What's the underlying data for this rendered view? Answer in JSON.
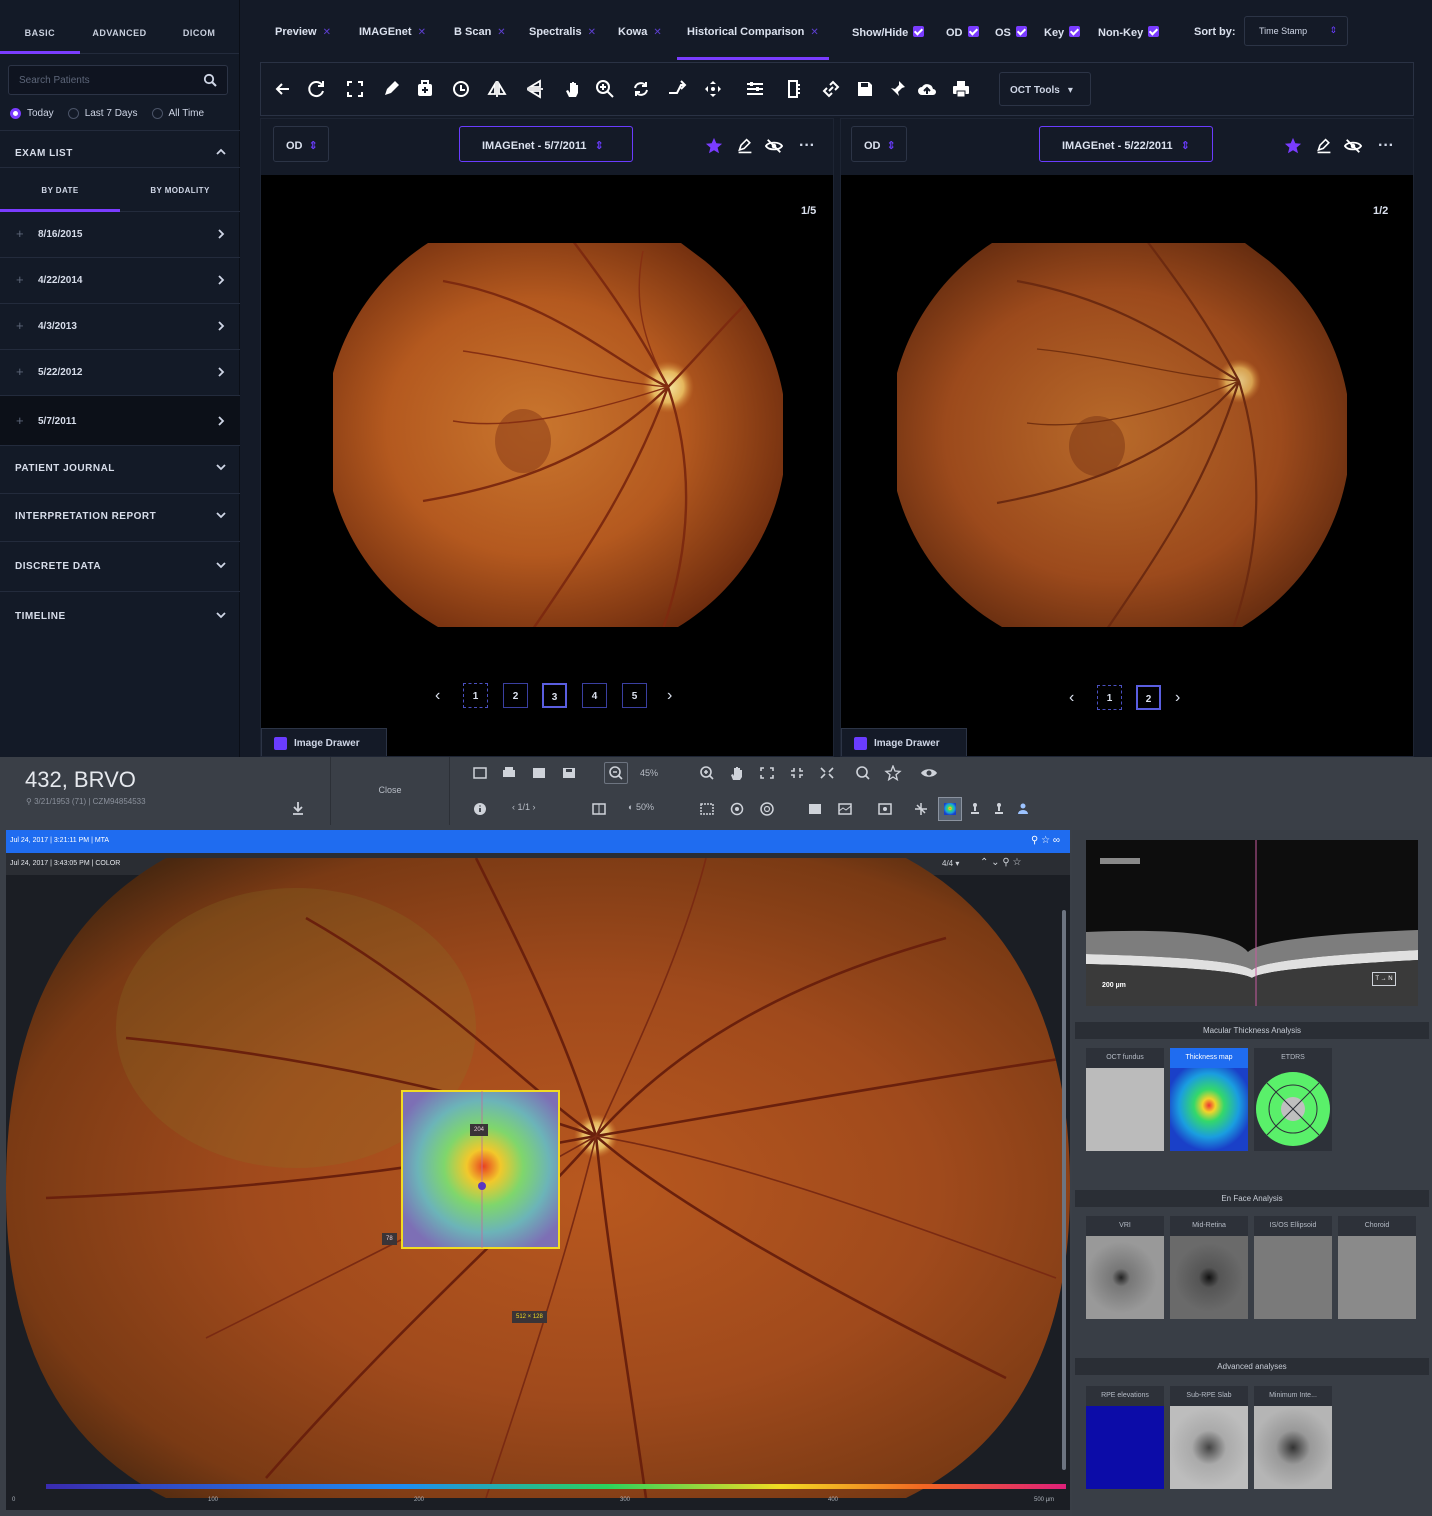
{
  "sidebar": {
    "tabs": [
      "BASIC",
      "ADVANCED",
      "DICOM"
    ],
    "search_placeholder": "Search Patients",
    "radios": [
      "Today",
      "Last 7 Days",
      "All Time"
    ],
    "exam_list_label": "EXAM LIST",
    "subtabs": [
      "BY DATE",
      "BY MODALITY"
    ],
    "dates": [
      "8/16/2015",
      "4/22/2014",
      "4/3/2013",
      "5/22/2012",
      "5/7/2011"
    ],
    "sections": [
      "PATIENT JOURNAL",
      "INTERPRETATION REPORT",
      "DISCRETE DATA",
      "TIMELINE"
    ]
  },
  "tabs": [
    {
      "label": "Preview"
    },
    {
      "label": "IMAGEnet"
    },
    {
      "label": "B Scan"
    },
    {
      "label": "Spectralis"
    },
    {
      "label": "Kowa"
    },
    {
      "label": "Historical Comparison"
    }
  ],
  "filters": {
    "show_hide": "Show/Hide",
    "od": "OD",
    "os": "OS",
    "key": "Key",
    "non_key": "Non-Key",
    "sort_by": "Sort by:",
    "sort_value": "Time Stamp"
  },
  "toolbar": {
    "oct_tools": "OCT Tools"
  },
  "left_viewer": {
    "eye": "OD",
    "image": "IMAGEnet - 5/7/2011",
    "counter": "1/5",
    "pages": [
      "1",
      "2",
      "3",
      "4",
      "5"
    ],
    "drawer": "Image Drawer"
  },
  "right_viewer": {
    "eye": "OD",
    "image": "IMAGEnet - 5/22/2011",
    "counter": "1/2",
    "pages": [
      "1",
      "2"
    ],
    "drawer": "Image Drawer"
  },
  "patient": {
    "title": "432, BRVO",
    "info": "3/21/1953 (71) | CZM94854533",
    "close": "Close"
  },
  "viewer2": {
    "zoom": "45%",
    "page": "1/1",
    "opacity": "50%",
    "bar1": "Jul 24, 2017 | 3:21:11 PM | MTA",
    "bar2": "Jul 24, 2017 | 3:43:05 PM | COLOR",
    "bar2_right": "4/4",
    "label_top": "204",
    "label_left": "78",
    "label_bottom": "512 × 128",
    "scale": [
      "0",
      "100",
      "200",
      "300",
      "400",
      "500 µm"
    ]
  },
  "oct": {
    "scale": "200 µm",
    "dir": "T → N"
  },
  "macular": {
    "title": "Macular Thickness Analysis",
    "items": [
      "OCT fundus",
      "Thickness map",
      "ETDRS"
    ]
  },
  "enface": {
    "title": "En Face Analysis",
    "items": [
      "VRI",
      "Mid-Retina",
      "IS/OS Ellipsoid",
      "Choroid"
    ]
  },
  "advanced": {
    "title": "Advanced analyses",
    "items": [
      "RPE elevations",
      "Sub-RPE Slab",
      "Minimum Inte..."
    ]
  }
}
